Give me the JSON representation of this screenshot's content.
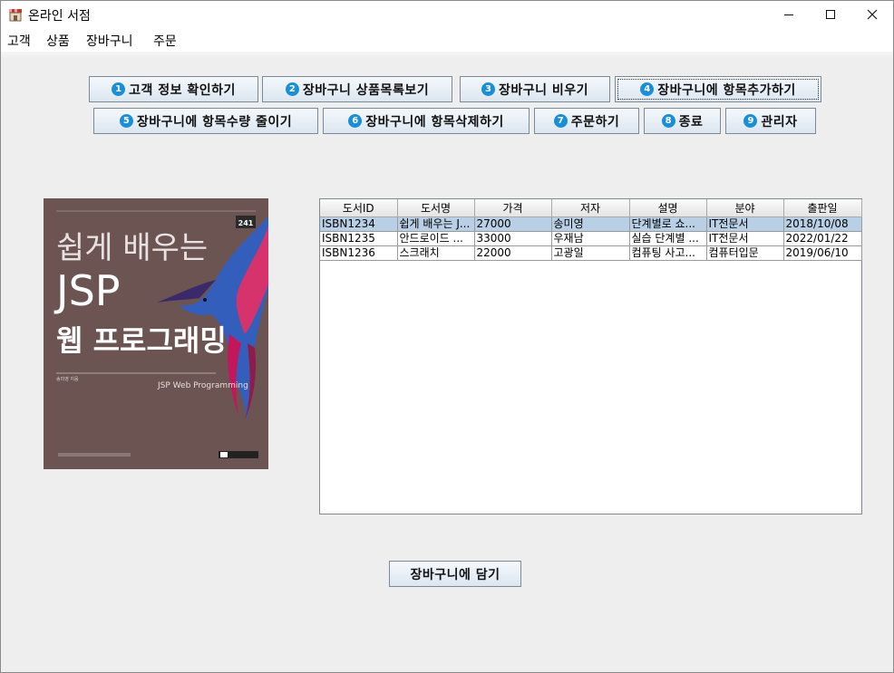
{
  "window": {
    "title": "온라인 서점"
  },
  "menu": [
    "고객",
    "상품",
    "장바구니",
    "주문"
  ],
  "toolbar": {
    "row1": [
      {
        "num": "1",
        "label": "고객 정보 확인하기"
      },
      {
        "num": "2",
        "label": "장바구니 상품목록보기"
      },
      {
        "num": "3",
        "label": "장바구니 비우기"
      },
      {
        "num": "4",
        "label": "장바구니에 항목추가하기"
      }
    ],
    "row2": [
      {
        "num": "5",
        "label": "장바구니에 항목수량 줄이기"
      },
      {
        "num": "6",
        "label": "장바구니에 항목삭제하기"
      },
      {
        "num": "7",
        "label": "주문하기"
      },
      {
        "num": "8",
        "label": "종료"
      },
      {
        "num": "9",
        "label": "관리자"
      }
    ]
  },
  "cover": {
    "series_no": "241",
    "title_line1": "쉽게 배우는",
    "title_line2": "JSP",
    "title_line3": "웹 프로그래밍",
    "subtitle": "JSP Web Programming",
    "author": "송미영 지음"
  },
  "table": {
    "headers": [
      "도서ID",
      "도서명",
      "가격",
      "저자",
      "설명",
      "분야",
      "출판일"
    ],
    "rows": [
      [
        "ISBN1234",
        "쉽게 배우는 J...",
        "27000",
        "송미영",
        "단계별로 쇼...",
        "IT전문서",
        "2018/10/08"
      ],
      [
        "ISBN1235",
        "안드로이드 ...",
        "33000",
        "우재남",
        "실습 단계별 ...",
        "IT전문서",
        "2022/01/22"
      ],
      [
        "ISBN1236",
        "스크래치",
        "22000",
        "고광일",
        "컴퓨팅 사고...",
        "컴퓨터입문",
        "2019/06/10"
      ]
    ]
  },
  "add_to_cart_label": "장바구니에 담기"
}
